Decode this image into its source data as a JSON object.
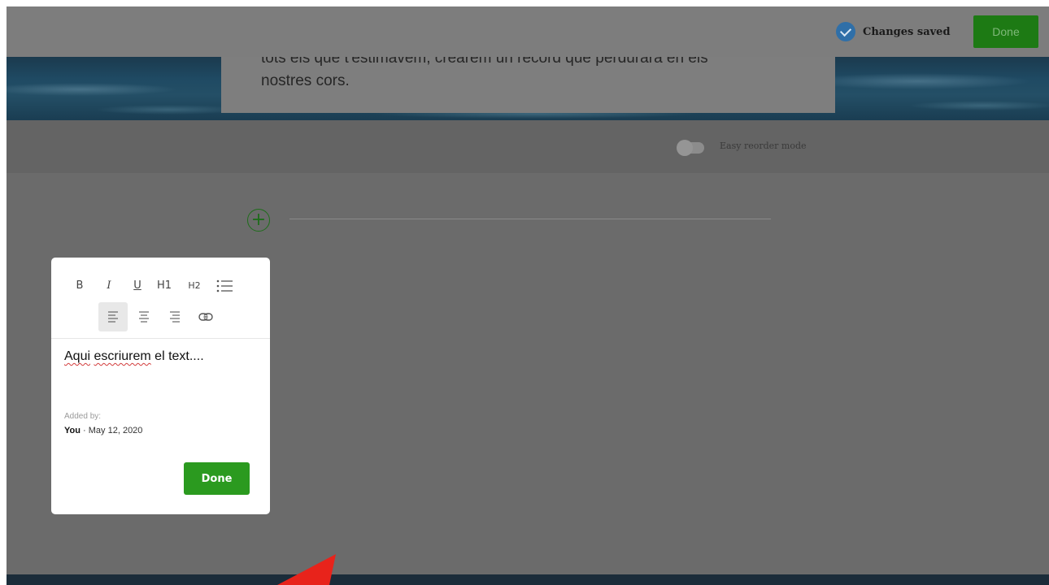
{
  "header": {
    "status_label": "Changes saved",
    "status_icon": "check-circle-icon",
    "done_label": "Done"
  },
  "hero": {
    "text_lines": [
      "tots els que t'estimàvem, crearem un record que perdurarà en els",
      "nostres cors."
    ]
  },
  "reorder": {
    "label": "Easy reorder mode",
    "enabled": false
  },
  "content": {
    "add_icon": "plus-circle-icon"
  },
  "editor": {
    "toolbar": {
      "bold": "B",
      "italic": "I",
      "underline": "U",
      "h1": "H1",
      "h2": "H2",
      "list_icon": "bullet-list-icon",
      "align_left_icon": "align-left-icon",
      "align_center_icon": "align-center-icon",
      "align_right_icon": "align-right-icon",
      "link_icon": "link-icon"
    },
    "text_first_word": "Aqui",
    "text_second_word": "escriurem",
    "text_rest": " el text....",
    "added_by_label": "Added by:",
    "author": "You",
    "separator": "·",
    "date": "May 12, 2020",
    "done_label": "Done"
  },
  "colors": {
    "accent_green": "#2b9a1f",
    "saved_blue": "#2f6fa8",
    "annotation_red": "#e8231b"
  }
}
